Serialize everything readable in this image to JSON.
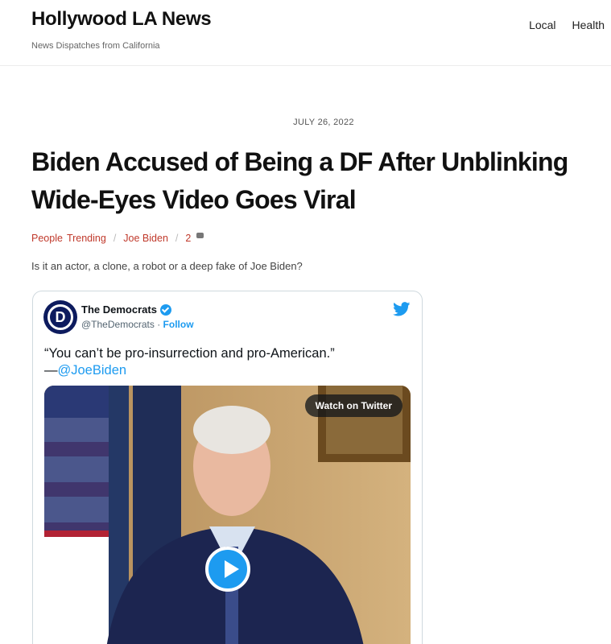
{
  "site": {
    "title": "Hollywood LA News",
    "tagline": "News Dispatches from California"
  },
  "nav": {
    "items": [
      "Local",
      "Health"
    ]
  },
  "post": {
    "date": "JULY 26, 2022",
    "title": "Biden Accused of Being a DF After Unblinking Wide-Eyes Video Goes Viral",
    "categories": [
      "People",
      "Trending"
    ],
    "tag": "Joe Biden",
    "comment_count": "2",
    "excerpt": "Is it an actor, a clone, a robot or a deep fake of Joe Biden?"
  },
  "tweet": {
    "author": "The Democrats",
    "avatar_letter": "D",
    "handle": "@TheDemocrats",
    "handle_sep": " · ",
    "follow": "Follow",
    "text": "“You can’t be pro-insurrection and pro-American.”",
    "signature": "—",
    "mention": "@JoeBiden",
    "watch_label": "Watch on Twitter",
    "icons": {
      "verified": "verified-badge-icon",
      "twitter": "twitter-bird-icon",
      "play": "play-icon"
    }
  },
  "colors": {
    "link_red": "#c0392b",
    "twitter_blue": "#1d9bf0",
    "avatar_navy": "#0d1b5e"
  }
}
